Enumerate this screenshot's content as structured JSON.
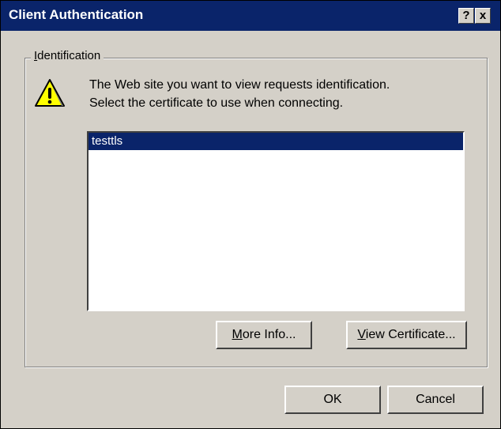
{
  "window": {
    "title": "Client Authentication",
    "help_glyph": "?",
    "close_glyph": "x",
    "title_bar_color": "#0a246a",
    "face_color": "#d4d0c8"
  },
  "group": {
    "legend_first": "I",
    "legend_rest": "dentification",
    "icon": "warning-icon",
    "message_line1": "The Web site you want to view requests identification.",
    "message_line2": "Select the certificate to use when connecting."
  },
  "certificates": {
    "items": [
      "testtls"
    ],
    "selected": "testtls",
    "selection_color": "#0a246a"
  },
  "buttons": {
    "more_info_first": "M",
    "more_info_rest": "ore Info...",
    "view_cert_first": "V",
    "view_cert_rest": "iew Certificate...",
    "ok": "OK",
    "cancel": "Cancel"
  }
}
